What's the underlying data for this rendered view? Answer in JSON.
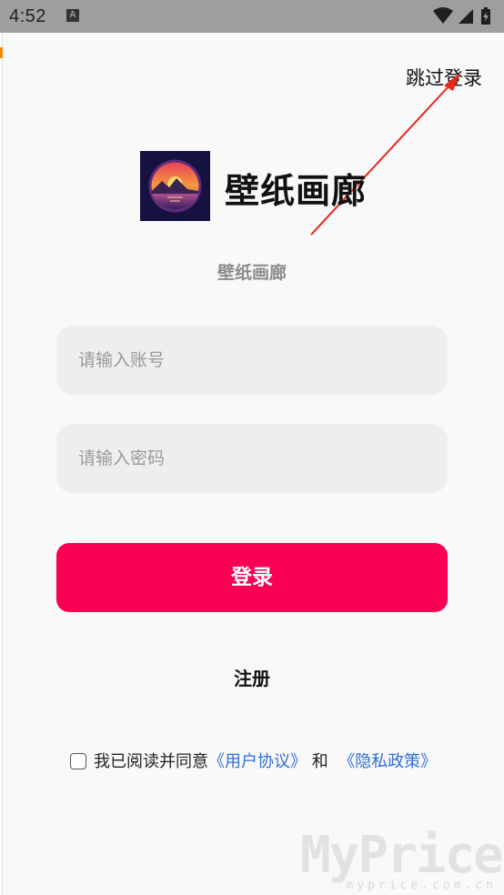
{
  "status_bar": {
    "time": "4:52",
    "notification_badge": "A"
  },
  "header": {
    "skip_login": "跳过登录"
  },
  "brand": {
    "app_name": "壁纸画廊",
    "subtitle": "壁纸画廊",
    "logo_icon": "sunset-landscape-logo"
  },
  "form": {
    "account_placeholder": "请输入账号",
    "password_placeholder": "请输入密码",
    "login_label": "登录",
    "register_label": "注册",
    "accent_color": "#fa0052"
  },
  "agreement": {
    "prefix": "我已阅读并同意",
    "user_agreement": "《用户协议》",
    "conjunction": "和",
    "privacy_policy": "《隐私政策》",
    "checked": false,
    "link_color": "#2f6fd6"
  },
  "watermark": {
    "text": "MyPrice",
    "sub": "myprice.com.cn"
  }
}
